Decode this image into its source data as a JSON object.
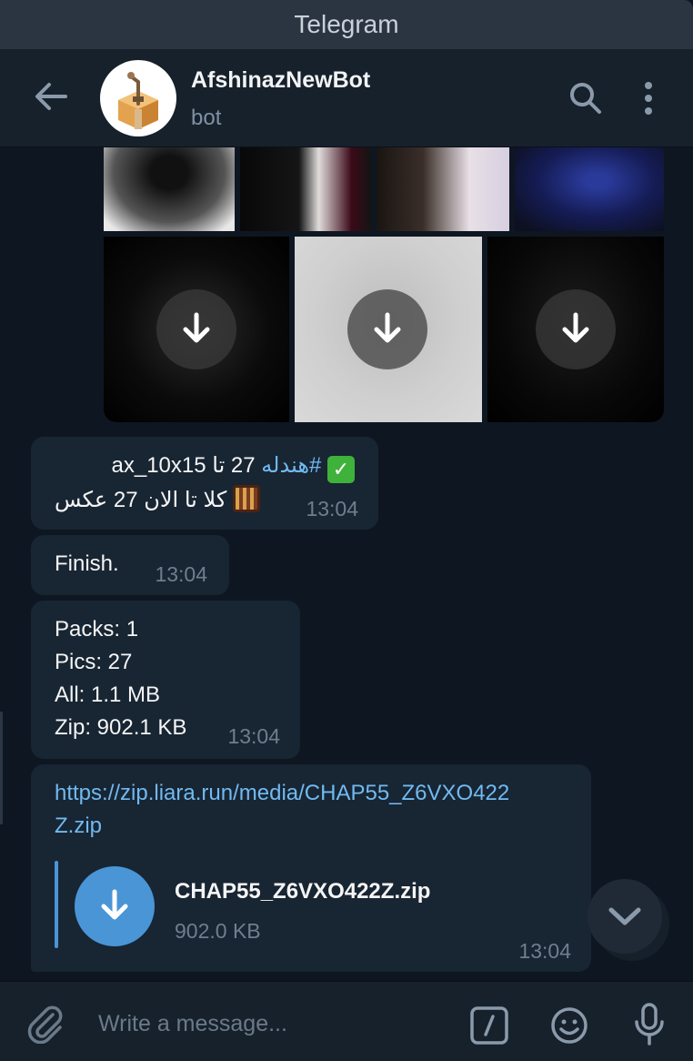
{
  "window": {
    "title": "Telegram"
  },
  "header": {
    "name": "AfshinazNewBot",
    "status": "bot"
  },
  "messages": {
    "album_caption": {
      "line1_rtl": "✅ #هندله 27 تا ax_10x15",
      "line1_tag": "#هندله",
      "line1_rest": " 27 تا ax_10x15",
      "line2": "کلا تا الان 27 عکس",
      "time": "13:04"
    },
    "finish": {
      "text": "Finish.",
      "time": "13:04"
    },
    "stats": {
      "lines": [
        "Packs: 1",
        "Pics: 27",
        "All: 1.1 MB",
        "Zip: 902.1 KB"
      ],
      "time": "13:04"
    },
    "file": {
      "link_line1": "https://zip.liara.run/media/CHAP55_Z6VXO422",
      "link_line2": "Z.zip",
      "file_name": "CHAP55_Z6VXO422Z.zip",
      "file_size": "902.0 KB",
      "time": "13:04"
    }
  },
  "composer": {
    "placeholder": "Write a message..."
  },
  "colors": {
    "accent": "#4a95d6",
    "link": "#71baf0",
    "bubble": "#182533",
    "background": "#0e1621"
  }
}
